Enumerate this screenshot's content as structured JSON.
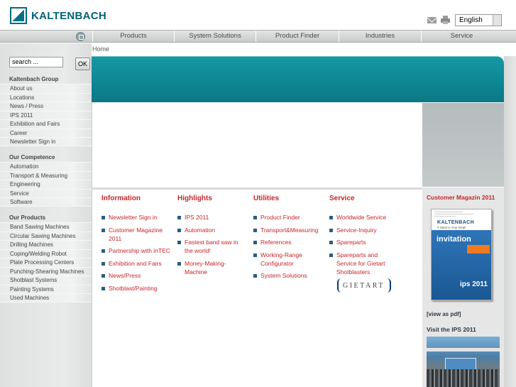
{
  "header": {
    "brand": "KALTENBACH",
    "icons": {
      "mail": "mail-icon",
      "print": "print-icon"
    },
    "language_selected": "English"
  },
  "topnav": {
    "home_icon": "home-icon",
    "items": [
      {
        "label": "Products"
      },
      {
        "label": "System Solutions"
      },
      {
        "label": "Product Finder"
      },
      {
        "label": "Industries"
      },
      {
        "label": "Service"
      }
    ]
  },
  "breadcrumb": "Home",
  "search": {
    "value": "search ...",
    "button": "OK"
  },
  "sidebar": {
    "groups": [
      {
        "title": "Kaltenbach Group",
        "items": [
          "About us",
          "Locations",
          "News / Press",
          "IPS 2011",
          "Exhibition and Fairs",
          "Career",
          "Newsletter Sign in"
        ]
      },
      {
        "title": "Our Competence",
        "items": [
          "Automation",
          "Transport & Measuring",
          "Engineering",
          "Service",
          "Software"
        ]
      },
      {
        "title": "Our Products",
        "items": [
          "Band Sawing Machines",
          "Circular Sawing Machines",
          "Drilling Machines",
          "Coping/Welding Robot",
          "Plate Processing Centers",
          "Punching-Shearing Machines",
          "Shotblast Systems",
          "Painting Systems",
          "Used Machines"
        ]
      }
    ]
  },
  "columns": [
    {
      "title": "Information",
      "links": [
        "Newsletter Sign in",
        "Customer Magazine 2011",
        "Partnership with inTEC",
        "Exhibition and Fairs",
        "News/Press",
        "Shotblast/Painting"
      ]
    },
    {
      "title": "Highlights",
      "links": [
        "IPS 2011",
        "Automation",
        "Fastest band saw in the world!",
        "Money-Making-Machine"
      ]
    },
    {
      "title": "Utilities",
      "links": [
        "Product Finder",
        "Transport&Measuring",
        "References",
        "Working-Range Configurator",
        "System Solutions"
      ]
    },
    {
      "title": "Service",
      "links": [
        "Worldwide Service",
        "Service-Inquiry",
        "Spareparts",
        "Spareparts and Service for Gietart Shotblasters"
      ]
    }
  ],
  "gietart_logo": "GIETART",
  "right": {
    "magazine_title": "Customer Magazin 2011",
    "magazine_cover": {
      "brand": "KALTENBACH",
      "tagline": "# Steel is Your Deal!",
      "headline": "invitation",
      "event": "ips 2011"
    },
    "view_pdf": "[view as pdf]",
    "visit": "Visit the IPS 2011"
  },
  "colors": {
    "teal": "#0f8794",
    "red": "#c6262c",
    "bullet": "#2a5d84"
  }
}
